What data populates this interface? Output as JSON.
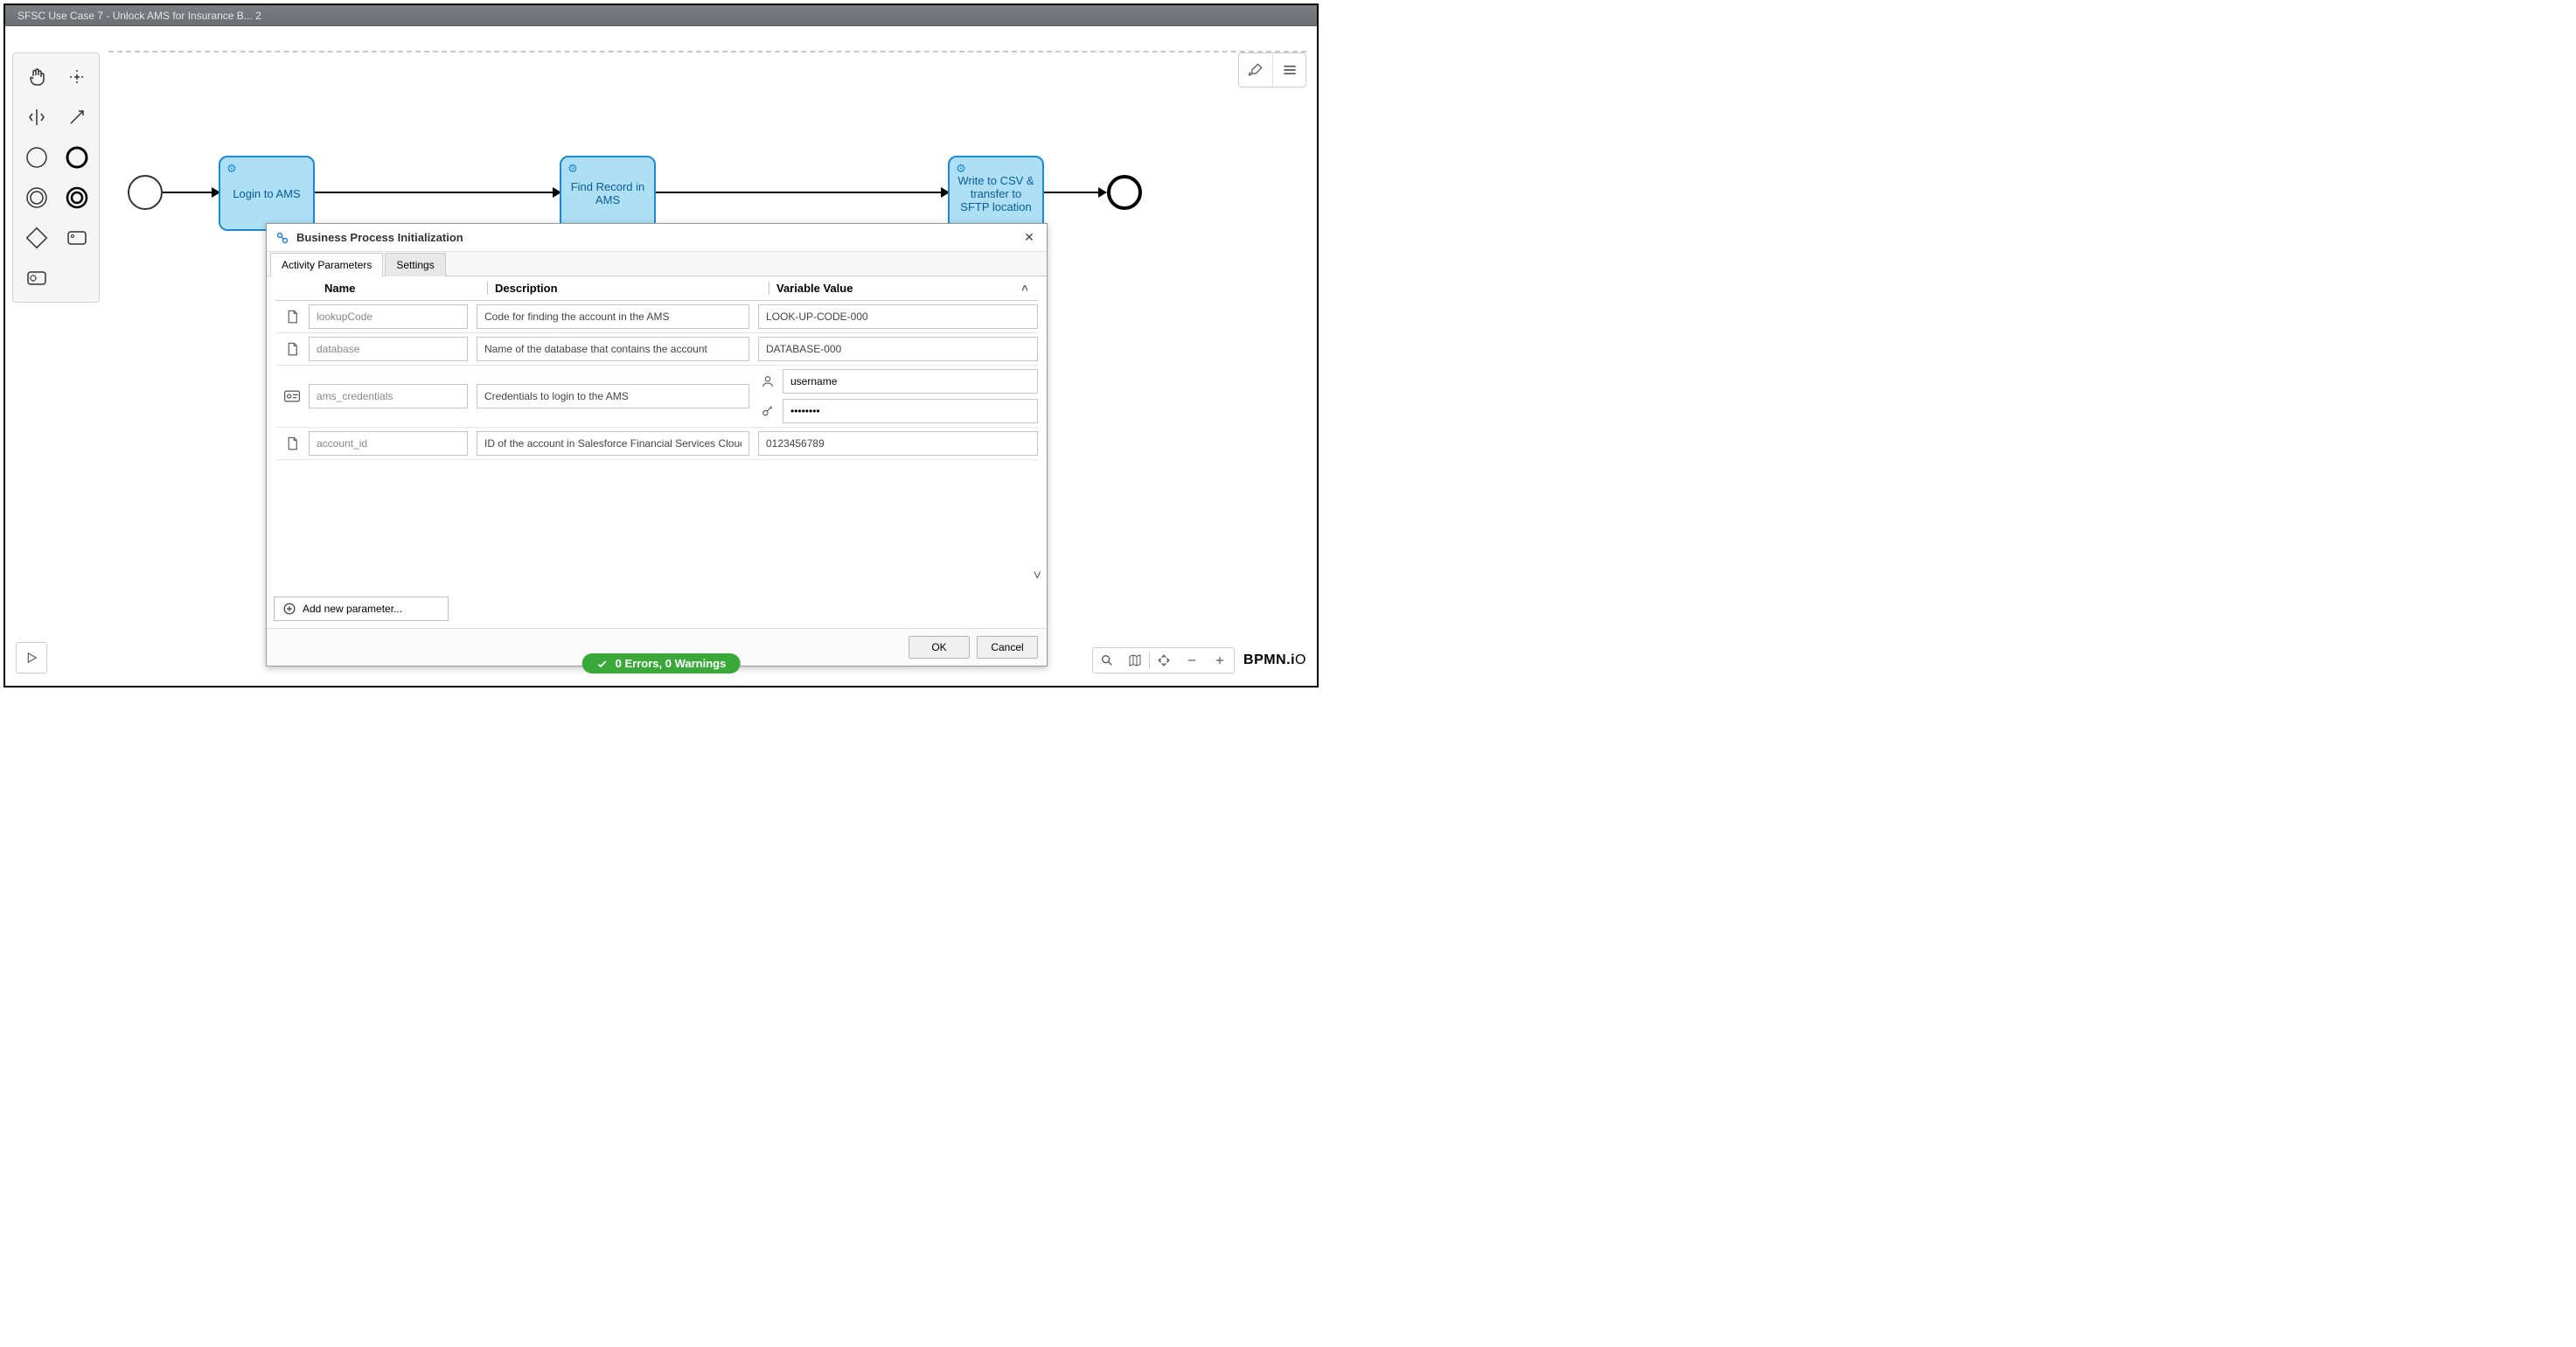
{
  "window": {
    "title": "SFSC Use Case 7 - Unlock AMS for Insurance B... 2"
  },
  "diagram": {
    "tasks": [
      {
        "label": "Login to AMS"
      },
      {
        "label": "Find Record in AMS"
      },
      {
        "label": "Write to CSV & transfer to SFTP location"
      }
    ]
  },
  "dialog": {
    "title": "Business Process Initialization",
    "tabs": {
      "params": "Activity Parameters",
      "settings": "Settings"
    },
    "columns": {
      "name": "Name",
      "desc": "Description",
      "val": "Variable Value"
    },
    "rows": [
      {
        "name": "lookupCode",
        "desc": "Code for finding the account in the AMS",
        "value": "LOOK-UP-CODE-000",
        "type": "text"
      },
      {
        "name": "database",
        "desc": "Name of the database that contains the account",
        "value": "DATABASE-000",
        "type": "text"
      },
      {
        "name": "ams_credentials",
        "desc": "Credentials to login to the AMS",
        "username": "username",
        "password": "••••••••",
        "type": "cred"
      },
      {
        "name": "account_id",
        "desc": "ID of the account in Salesforce Financial Services Cloud",
        "value": "0123456789",
        "type": "text"
      }
    ],
    "add_label": "Add new parameter...",
    "ok": "OK",
    "cancel": "Cancel"
  },
  "status": {
    "text": "0 Errors, 0 Warnings"
  },
  "logo": "BPMN.iO"
}
